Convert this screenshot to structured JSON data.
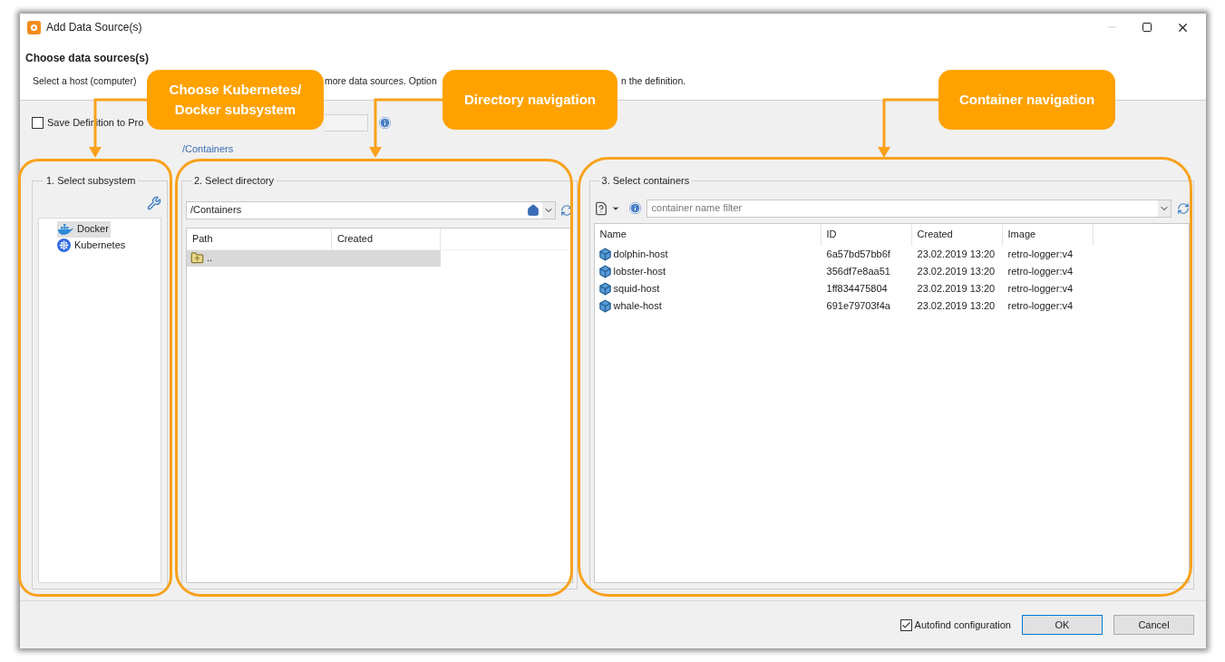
{
  "window": {
    "title": "Add Data Source(s)"
  },
  "header": {
    "title": "Choose data sources(s)",
    "description_fragments": [
      "Select a host (computer)",
      "more data sources. Option",
      "n the definition."
    ]
  },
  "save_definition": {
    "label": "Save Definition to Pro",
    "checked": false
  },
  "breadcrumb": "/Containers",
  "subsystem": {
    "legend": "1. Select subsystem",
    "items": [
      {
        "label": "Docker",
        "kind": "docker",
        "selected": true
      },
      {
        "label": "Kubernetes",
        "kind": "kubernetes",
        "selected": false
      }
    ]
  },
  "directory": {
    "legend": "2. Select directory",
    "path": "/Containers",
    "columns": [
      "Path",
      "Created"
    ],
    "rows": [
      {
        "path": "..",
        "selected": true
      }
    ]
  },
  "containers": {
    "legend": "3. Select containers",
    "filter_placeholder": "container name filter",
    "columns": [
      "Name",
      "ID",
      "Created",
      "Image"
    ],
    "rows": [
      {
        "name": "dolphin-host",
        "id": "6a57bd57bb6f",
        "created": "23.02.2019 13:20",
        "image": "retro-logger:v4"
      },
      {
        "name": "lobster-host",
        "id": "356df7e8aa51",
        "created": "23.02.2019 13:20",
        "image": "retro-logger:v4"
      },
      {
        "name": "squid-host",
        "id": "1ff834475804",
        "created": "23.02.2019 13:20",
        "image": "retro-logger:v4"
      },
      {
        "name": "whale-host",
        "id": "691e79703f4a",
        "created": "23.02.2019 13:20",
        "image": "retro-logger:v4"
      }
    ]
  },
  "footer": {
    "autofind": {
      "label": "Autofind configuration",
      "checked": true
    },
    "buttons": [
      {
        "label": "OK",
        "default": true
      },
      {
        "label": "Cancel",
        "default": false
      }
    ]
  },
  "callouts": [
    {
      "text": "Choose Kubernetes/\nDocker subsystem"
    },
    {
      "text": "Directory navigation"
    },
    {
      "text": "Container navigation"
    }
  ]
}
